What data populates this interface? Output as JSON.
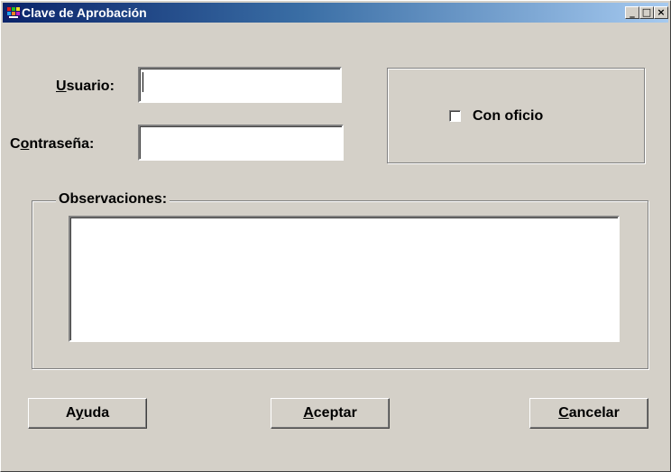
{
  "window": {
    "title": "Clave de Aprobación",
    "controls": {
      "minimize": "_",
      "maximize": "□",
      "close": "×"
    }
  },
  "form": {
    "user_label_mnemonic": "U",
    "user_label_rest": "suario:",
    "user_value": "",
    "password_label_first": "C",
    "password_label_mnemonic": "o",
    "password_label_rest": "ntraseña:",
    "password_value": ""
  },
  "options": {
    "con_oficio_label": "Con oficio",
    "con_oficio_checked": false
  },
  "observations": {
    "legend": "Observaciones:",
    "value": ""
  },
  "buttons": {
    "help_first": "A",
    "help_mnemonic": "y",
    "help_rest": "uda",
    "accept_mnemonic": "A",
    "accept_rest": "ceptar",
    "cancel_mnemonic": "C",
    "cancel_rest": "ancelar"
  },
  "icons": {
    "app": "app-icon",
    "minimize": "minimize-icon",
    "maximize": "maximize-icon",
    "close": "close-icon"
  }
}
